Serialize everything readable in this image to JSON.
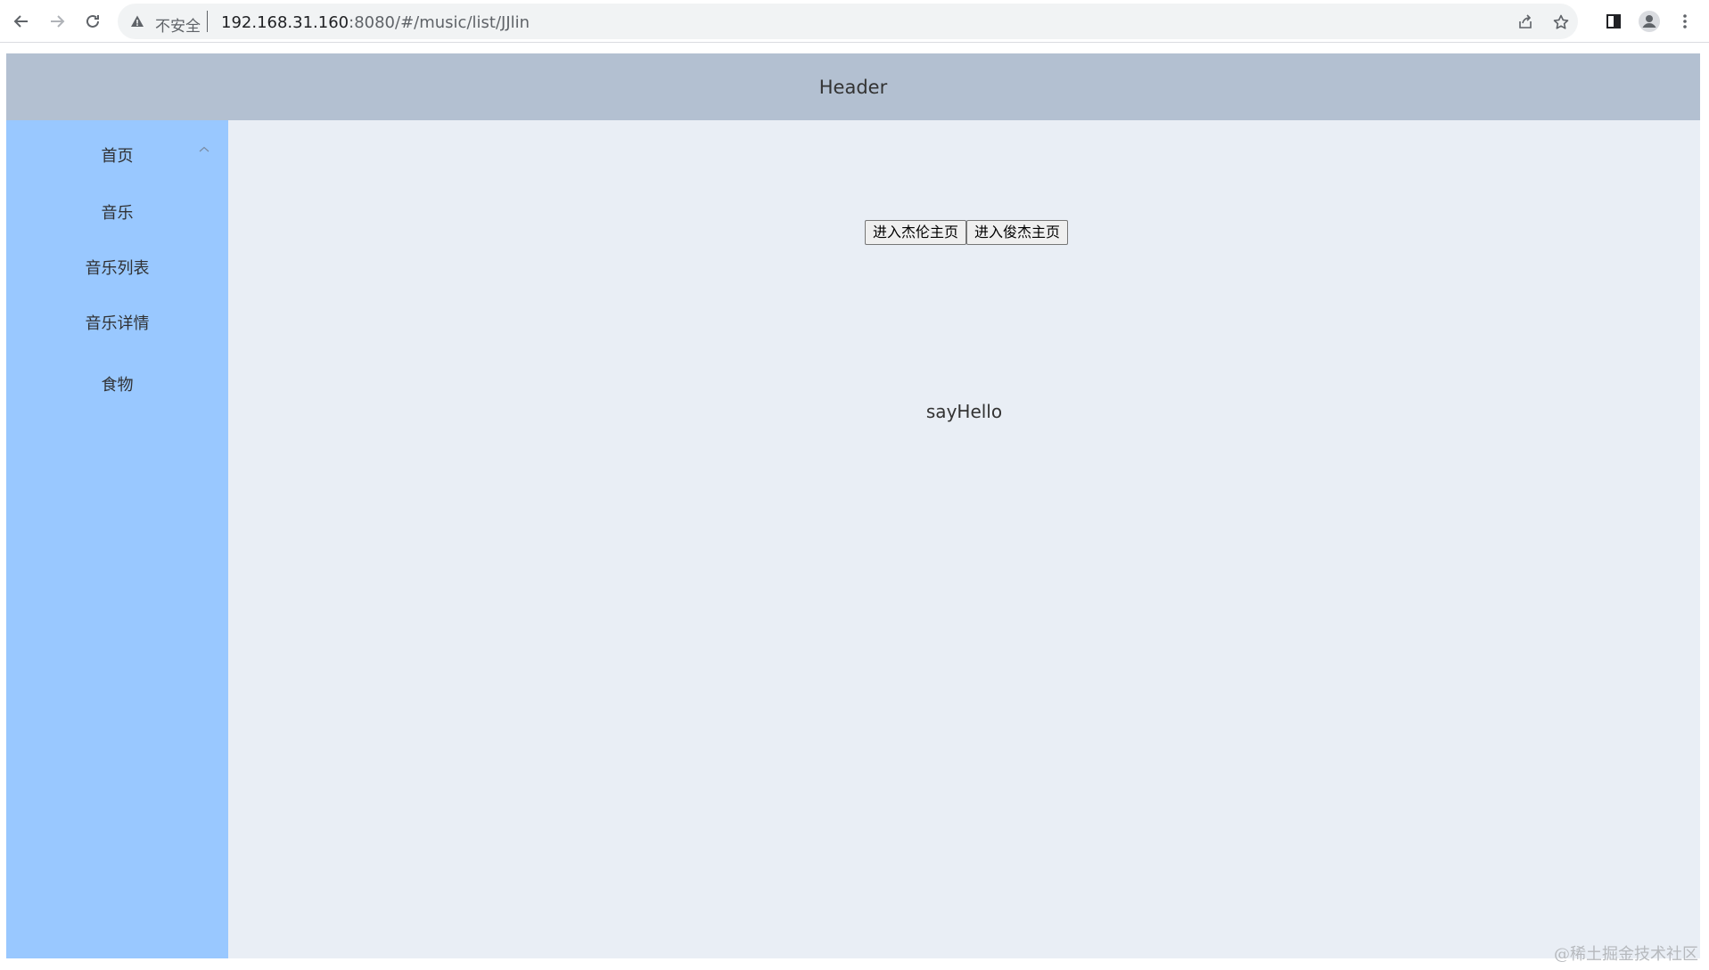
{
  "browser": {
    "security_label": "不安全",
    "url_host": "192.168.31.160",
    "url_rest": ":8080/#/music/list/JJlin",
    "icons": [
      "back-icon",
      "forward-icon",
      "reload-icon",
      "warning-icon",
      "share-icon",
      "star-icon",
      "side-panel-icon",
      "profile-icon",
      "more-icon"
    ]
  },
  "app": {
    "header_title": "Header",
    "sidebar": {
      "items": [
        {
          "label": "首页"
        },
        {
          "label": "音乐"
        },
        {
          "label": "音乐列表"
        },
        {
          "label": "音乐详情"
        },
        {
          "label": "食物"
        }
      ]
    },
    "main": {
      "buttons": [
        {
          "label": "进入杰伦主页"
        },
        {
          "label": "进入俊杰主页"
        }
      ],
      "message": "sayHello"
    },
    "colors": {
      "header_bg": "#b3c0d1",
      "sidebar_bg": "#99c8ff",
      "main_bg": "#e9eef5"
    }
  },
  "watermark": "@稀土掘金技术社区"
}
